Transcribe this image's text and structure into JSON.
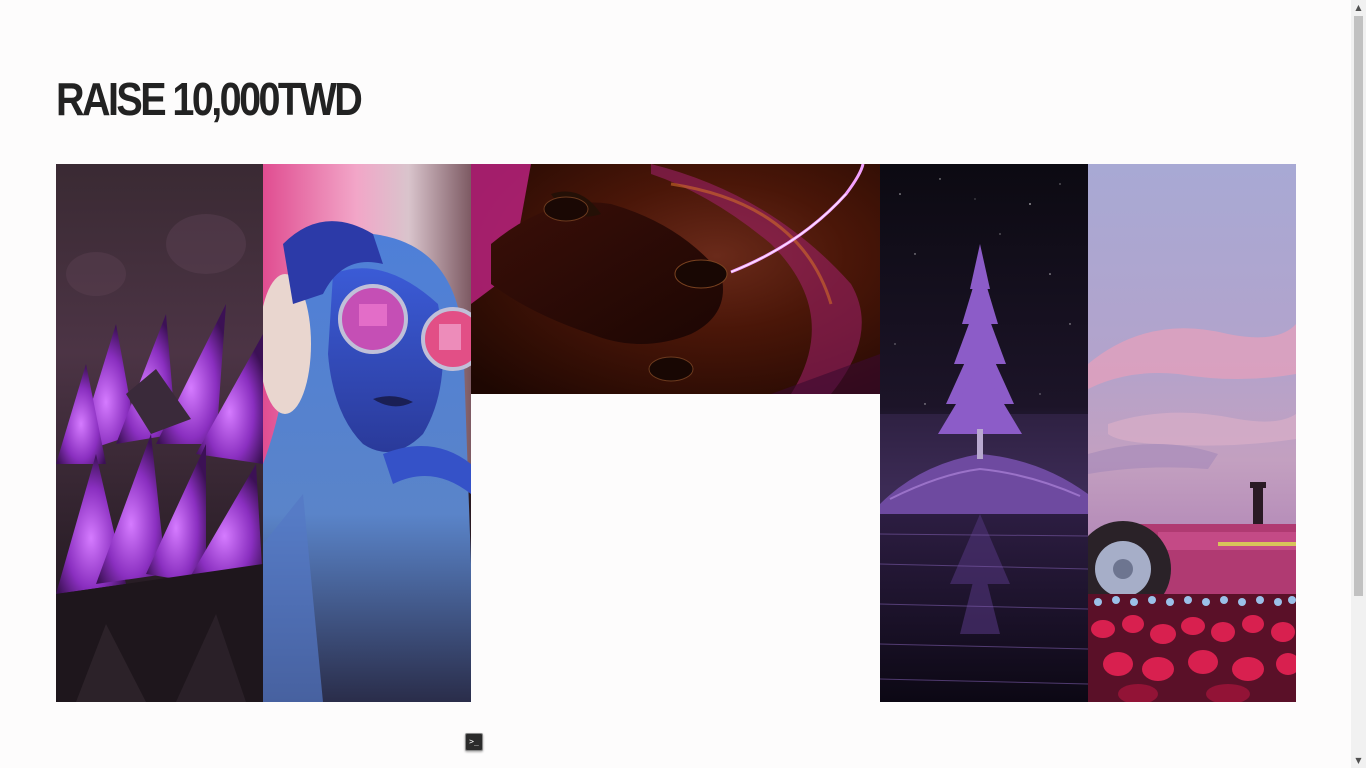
{
  "page": {
    "title": "RAISE 10,000TWD"
  },
  "gallery": {
    "images": [
      {
        "id": "purple-flowers",
        "icon": "purple-flower-photo"
      },
      {
        "id": "woman-sunglasses",
        "icon": "woman-neon-sunglasses-photo"
      },
      {
        "id": "hand-plasma",
        "icon": "hand-plasma-ball-photo"
      },
      {
        "id": "purple-tree",
        "icon": "purple-tree-night-photo"
      },
      {
        "id": "tractor-tulips",
        "icon": "tractor-tulip-field-photo"
      }
    ]
  },
  "terminal_button": {
    "glyph": ">_",
    "icon": "terminal-icon"
  },
  "scrollbar": {
    "up_glyph": "▲",
    "down_glyph": "▼"
  },
  "colors": {
    "background": "#fdfcfc",
    "title": "#222222",
    "accent_purple": "#8a3fc4",
    "accent_blue": "#2f6fe0",
    "accent_pink": "#e0307a"
  }
}
